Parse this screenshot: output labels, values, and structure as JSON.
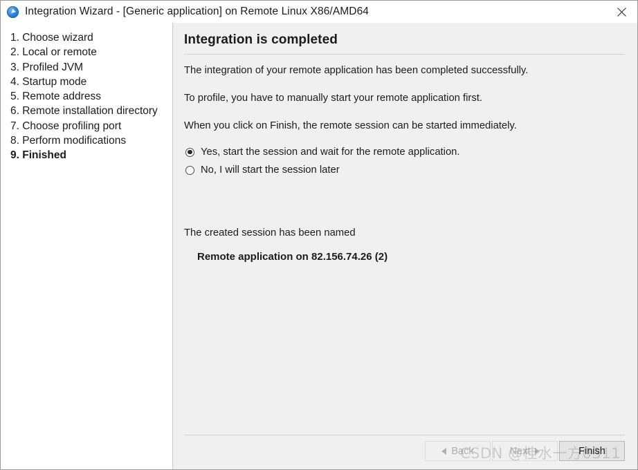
{
  "window": {
    "title": "Integration Wizard - [Generic application] on Remote Linux X86/AMD64",
    "app_icon": "compass-icon",
    "close_icon": "close-icon"
  },
  "sidebar": {
    "steps": [
      {
        "label": "1. Choose wizard",
        "current": false
      },
      {
        "label": "2. Local or remote",
        "current": false
      },
      {
        "label": "3. Profiled JVM",
        "current": false
      },
      {
        "label": "4. Startup mode",
        "current": false
      },
      {
        "label": "5. Remote address",
        "current": false
      },
      {
        "label": "6. Remote installation directory",
        "current": false
      },
      {
        "label": "7. Choose profiling port",
        "current": false
      },
      {
        "label": "8. Perform modifications",
        "current": false
      },
      {
        "label": "9. Finished",
        "current": true
      }
    ]
  },
  "main": {
    "heading": "Integration is completed",
    "paragraph_1": "The integration of your remote application has been completed successfully.",
    "paragraph_2": "To profile, you have to manually start your remote application first.",
    "paragraph_3": "When you click on Finish, the remote session can be started immediately.",
    "options": [
      {
        "label": "Yes, start the session and wait for the remote application.",
        "selected": true
      },
      {
        "label": "No, I will start the session later",
        "selected": false
      }
    ],
    "session_caption": "The created session has been named",
    "session_name": "Remote application on 82.156.74.26 (2)"
  },
  "buttons": {
    "back": "Back",
    "next": "Next",
    "finish": "Finish"
  },
  "watermark": {
    "text": "CSDN @桂水一方0311"
  }
}
